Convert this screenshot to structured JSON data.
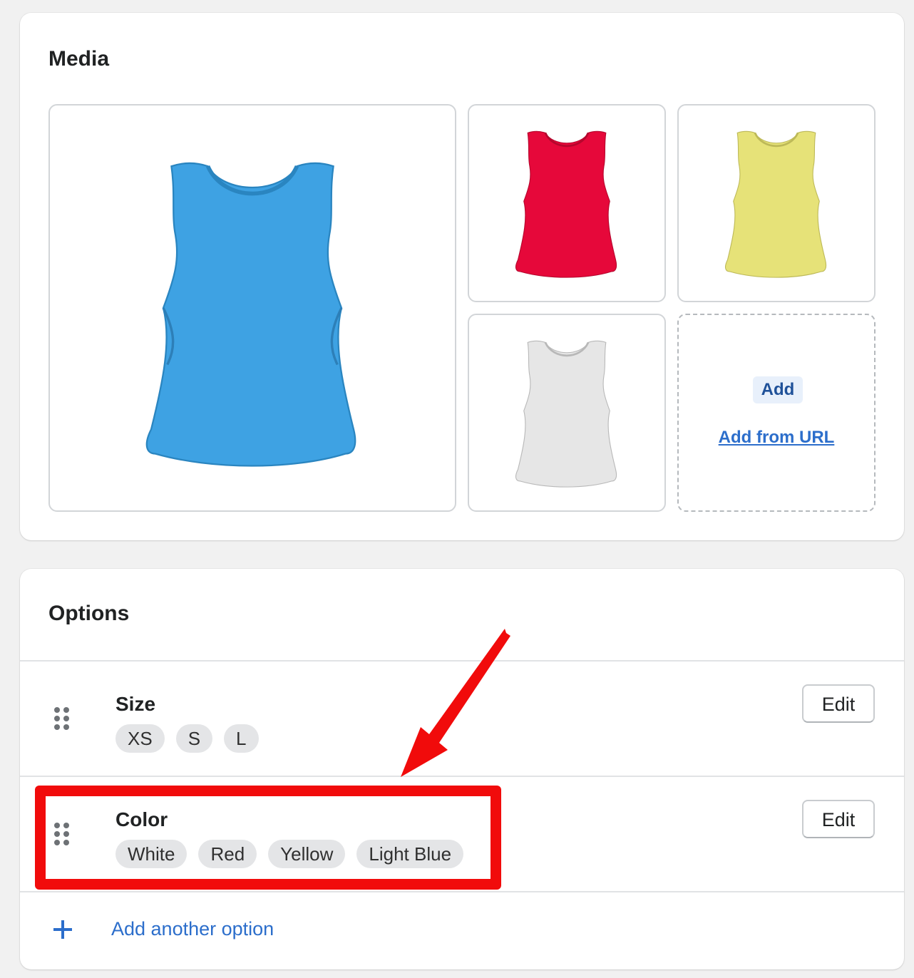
{
  "media": {
    "title": "Media",
    "images": [
      {
        "name": "tank-top-light-blue",
        "color": "#3ea2e3"
      },
      {
        "name": "tank-top-red",
        "color": "#e6083a"
      },
      {
        "name": "tank-top-yellow",
        "color": "#e6e278"
      },
      {
        "name": "tank-top-white",
        "color": "#e6e6e6"
      }
    ],
    "add_button": "Add",
    "add_from_url": "Add from URL"
  },
  "options": {
    "title": "Options",
    "items": [
      {
        "name": "Size",
        "values": [
          "XS",
          "S",
          "L"
        ],
        "edit_label": "Edit"
      },
      {
        "name": "Color",
        "values": [
          "White",
          "Red",
          "Yellow",
          "Light Blue"
        ],
        "edit_label": "Edit"
      }
    ],
    "add_another": "Add another option"
  },
  "annotation": {
    "highlight_color": "#f10b0b"
  },
  "colors": {
    "accent": "#2c6ecb",
    "chip_bg": "#e4e5e7"
  }
}
